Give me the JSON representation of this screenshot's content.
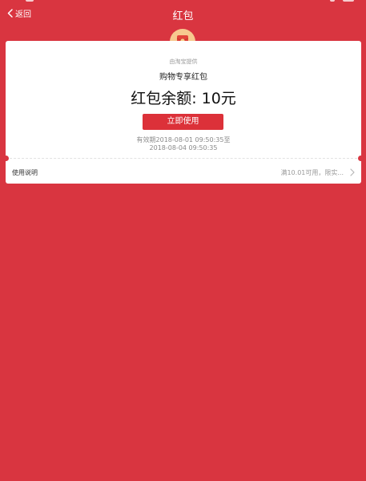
{
  "nav": {
    "back_label": "返回",
    "title": "红包"
  },
  "card": {
    "provider": "由淘宝提供",
    "packet_name": "购物专享红包",
    "balance": "红包余额: 10元",
    "use_button": "立即使用",
    "validity_line1": "有效期2018-08-01 09:50:35至",
    "validity_line2": "2018-08-04 09:50:35"
  },
  "instructions": {
    "label": "使用说明",
    "summary": "满10.01可用，限实..."
  },
  "colors": {
    "background": "#d93540",
    "button": "#dc3139",
    "emblem": "#f7c98f"
  }
}
